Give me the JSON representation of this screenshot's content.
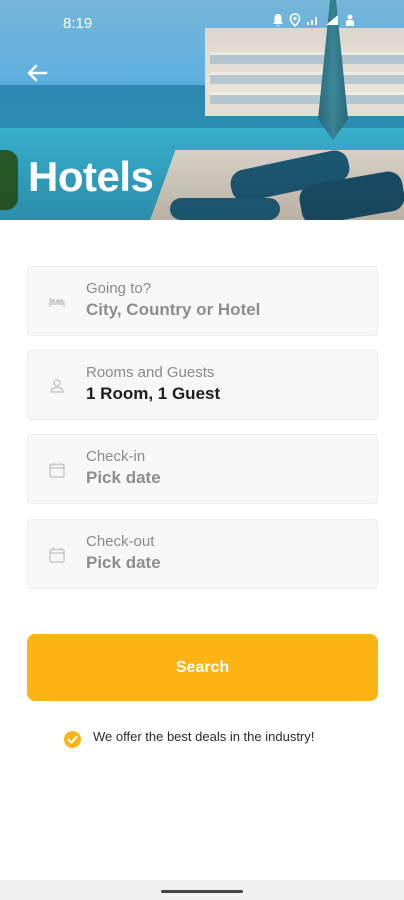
{
  "status_bar": {
    "time": "8:19",
    "icons": [
      "notification-icon",
      "location-icon",
      "wifi-icon",
      "signal-icon",
      "battery-icon"
    ]
  },
  "header": {
    "title": "Hotels",
    "back_icon": "arrow-left-icon"
  },
  "form": {
    "destination": {
      "label": "Going to?",
      "value": "City, Country or Hotel",
      "icon": "bed-icon",
      "is_placeholder": true
    },
    "rooms": {
      "label": "Rooms and Guests",
      "value": "1 Room, 1 Guest",
      "icon": "person-icon",
      "is_placeholder": false
    },
    "checkin": {
      "label": "Check-in",
      "value": "Pick date",
      "icon": "calendar-icon",
      "is_placeholder": true
    },
    "checkout": {
      "label": "Check-out",
      "value": "Pick date",
      "icon": "calendar-icon",
      "is_placeholder": true
    }
  },
  "search_button": {
    "label": "Search"
  },
  "deal_note": {
    "text": "We offer the best deals in the industry!",
    "icon": "check-circle-icon"
  },
  "colors": {
    "accent": "#fcb415",
    "field_bg": "#f7f7f7",
    "label_text": "#8a8a8a",
    "value_text": "#1e1e1e",
    "placeholder_value": "#8d8d8d"
  }
}
